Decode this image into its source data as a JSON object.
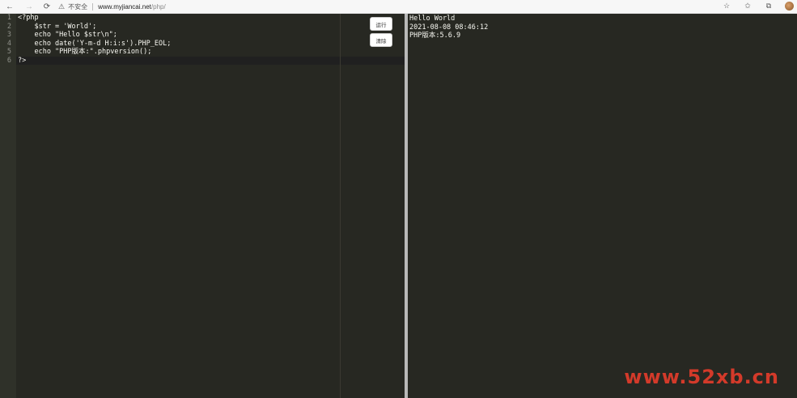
{
  "browser": {
    "security_label": "不安全",
    "url_host": "www.myjiancai.net",
    "url_path": "/php/"
  },
  "editor": {
    "line_numbers": [
      "1",
      "2",
      "3",
      "4",
      "5",
      "6"
    ],
    "lines": [
      "<?php",
      "    $str = 'World';",
      "    echo \"Hello $str\\n\";",
      "    echo date('Y-m-d H:i:s').PHP_EOL;",
      "    echo \"PHP版本:\".phpversion();",
      "?>"
    ],
    "run_button": "运行",
    "clear_button": "清除"
  },
  "output": {
    "lines": [
      "Hello World",
      "2021-08-08 08:46:12",
      "PHP版本:5.6.9"
    ]
  },
  "watermark": "www.52xb.cn"
}
